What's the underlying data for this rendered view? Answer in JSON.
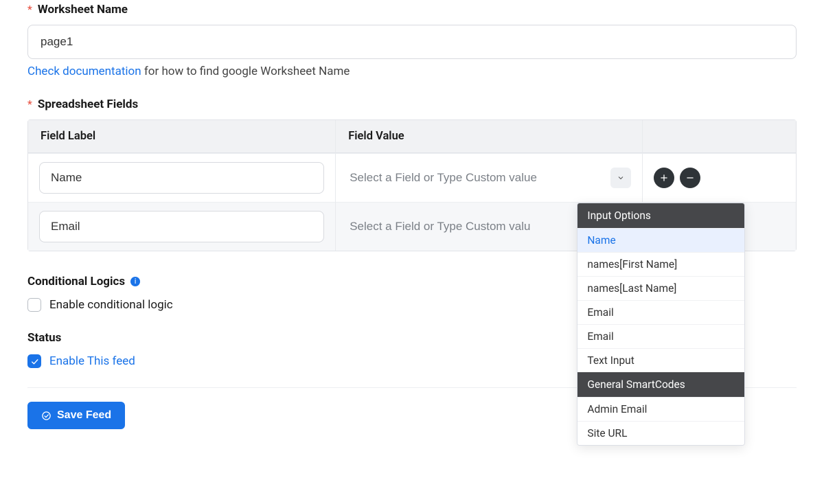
{
  "worksheet": {
    "label": "Worksheet Name",
    "value": "page1",
    "helper_link": "Check documentation",
    "helper_text": " for how to find google Worksheet Name"
  },
  "fields": {
    "label": "Spreadsheet Fields",
    "header_label": "Field Label",
    "header_value": "Field Value",
    "rows": [
      {
        "label": "Name",
        "placeholder": "Select a Field or Type Custom value"
      },
      {
        "label": "Email",
        "placeholder": "Select a Field or Type Custom valu"
      }
    ]
  },
  "dropdown": {
    "groups": [
      {
        "title": "Input Options",
        "items": [
          "Name",
          "names[First Name]",
          "names[Last Name]",
          "Email",
          "Email",
          "Text Input"
        ],
        "highlight": 0
      },
      {
        "title": "General SmartCodes",
        "items": [
          "Admin Email",
          "Site URL"
        ]
      }
    ]
  },
  "conditional": {
    "label": "Conditional Logics",
    "checkbox": "Enable conditional logic"
  },
  "status": {
    "label": "Status",
    "checkbox": "Enable This feed"
  },
  "save": "Save Feed"
}
